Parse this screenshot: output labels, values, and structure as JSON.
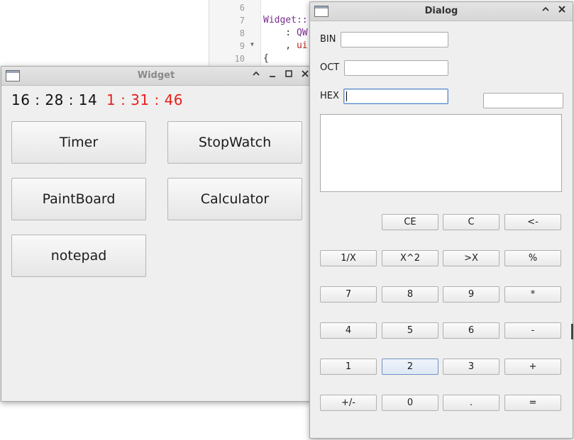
{
  "editor": {
    "line_numbers": [
      "6",
      "7",
      "8",
      "9",
      "10"
    ],
    "code_lines": [
      {
        "a": "Widget::",
        "b": ""
      },
      {
        "a": "    : ",
        "b": "QW"
      },
      {
        "a": "    , ",
        "b": "ui"
      },
      {
        "a": "{",
        "b": ""
      }
    ]
  },
  "widget_window": {
    "title": "Widget",
    "clock_time": "16 : 28 : 14",
    "stopwatch_time": "1 : 31 : 46",
    "buttons": [
      "Timer",
      "StopWatch",
      "PaintBoard",
      "Calculator",
      "notepad"
    ],
    "colors": {
      "stopwatch": "#e8201c"
    }
  },
  "dialog_window": {
    "title": "Dialog",
    "labels": {
      "bin": "BIN",
      "oct": "OCT",
      "hex": "HEX"
    },
    "fields": {
      "bin": "",
      "oct": "",
      "hex": "",
      "display": ""
    },
    "keypad": [
      [
        "",
        "CE",
        "C",
        "<-"
      ],
      [
        "1/X",
        "X^2",
        ">X",
        "%"
      ],
      [
        "7",
        "8",
        "9",
        "*"
      ],
      [
        "4",
        "5",
        "6",
        "-"
      ],
      [
        "1",
        "2",
        "3",
        "+"
      ],
      [
        "+/-",
        "0",
        ".",
        "="
      ]
    ]
  },
  "icons": [
    "window-icon",
    "minimize-icon",
    "maximize-icon",
    "restore-icon",
    "close-icon",
    "fold-arrow-icon"
  ]
}
